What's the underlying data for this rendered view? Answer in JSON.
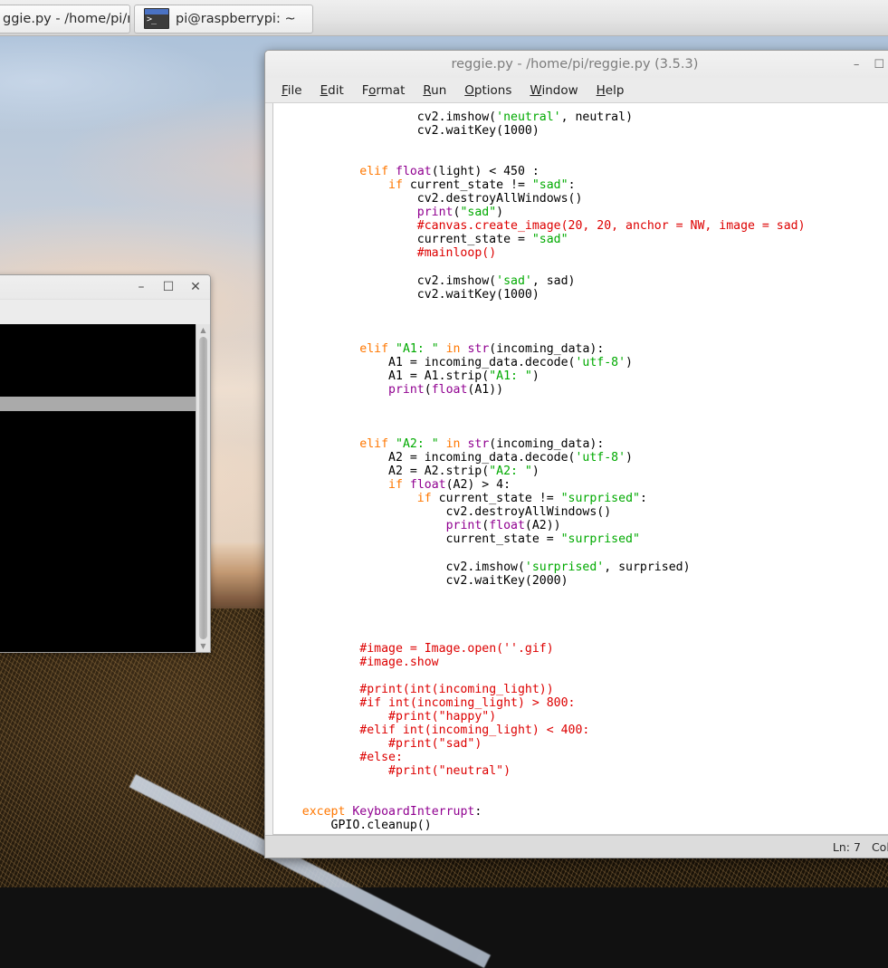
{
  "taskbar": {
    "items": [
      {
        "label": "ggie.py - /home/pi/r...",
        "icon": ""
      },
      {
        "label": "pi@raspberrypi: ~",
        "icon": "terminal-icon"
      }
    ]
  },
  "terminal_window": {
    "controls": {
      "minimize": "–",
      "maximize": "☐",
      "close": "✕"
    },
    "scroll_up": "▲",
    "scroll_down": "▼"
  },
  "idle_window": {
    "title": "reggie.py - /home/pi/reggie.py (3.5.3)",
    "controls": {
      "minimize": "–",
      "maximize": "☐"
    },
    "menus": [
      {
        "label": "File",
        "mnemonic": "F"
      },
      {
        "label": "Edit",
        "mnemonic": "E"
      },
      {
        "label": "Format",
        "mnemonic": "o"
      },
      {
        "label": "Run",
        "mnemonic": "R"
      },
      {
        "label": "Options",
        "mnemonic": "O"
      },
      {
        "label": "Window",
        "mnemonic": "W"
      },
      {
        "label": "Help",
        "mnemonic": "H"
      }
    ],
    "status": {
      "line": "Ln: 7",
      "column": "Col:"
    },
    "code": "                    cv2.imshow(@s'neutral'@/, neutral)\n                    cv2.waitKey(1000)\n\n\n            @kelif@/ @bfloat@/(light) < 450 :\n                @kif@/ current_state != @s\"sad\"@/:\n                    cv2.destroyAllWindows()\n                    @bprint@/(@s\"sad\"@/)\n                    @c#canvas.create_image(20, 20, anchor = NW, image = sad)@/\n                    current_state = @s\"sad\"@/\n                    @c#mainloop()@/\n\n                    cv2.imshow(@s'sad'@/, sad)\n                    cv2.waitKey(1000)\n\n\n\n            @kelif@/ @s\"A1: \"@/ @kin@/ @bstr@/(incoming_data):\n                A1 = incoming_data.decode(@s'utf-8'@/)\n                A1 = A1.strip(@s\"A1: \"@/)\n                @bprint@/(@bfloat@/(A1))\n\n\n\n            @kelif@/ @s\"A2: \"@/ @kin@/ @bstr@/(incoming_data):\n                A2 = incoming_data.decode(@s'utf-8'@/)\n                A2 = A2.strip(@s\"A2: \"@/)\n                @kif@/ @bfloat@/(A2) > 4:\n                    @kif@/ current_state != @s\"surprised\"@/:\n                        cv2.destroyAllWindows()\n                        @bprint@/(@bfloat@/(A2))\n                        current_state = @s\"surprised\"@/\n\n                        cv2.imshow(@s'surprised'@/, surprised)\n                        cv2.waitKey(2000)\n\n\n\n\n            @c#image = Image.open(''.gif)@/\n            @c#image.show@/\n\n            @c#print(int(incoming_light))@/\n            @c#if int(incoming_light) > 800:@/\n                @c#print(\"happy\")@/\n            @c#elif int(incoming_light) < 400:@/\n                @c#print(\"sad\")@/\n            @c#else:@/\n                @c#print(\"neutral\")@/\n\n\n    @kexcept@/ @bKeyboardInterrupt@/:\n        GPIO.cleanup()"
  }
}
